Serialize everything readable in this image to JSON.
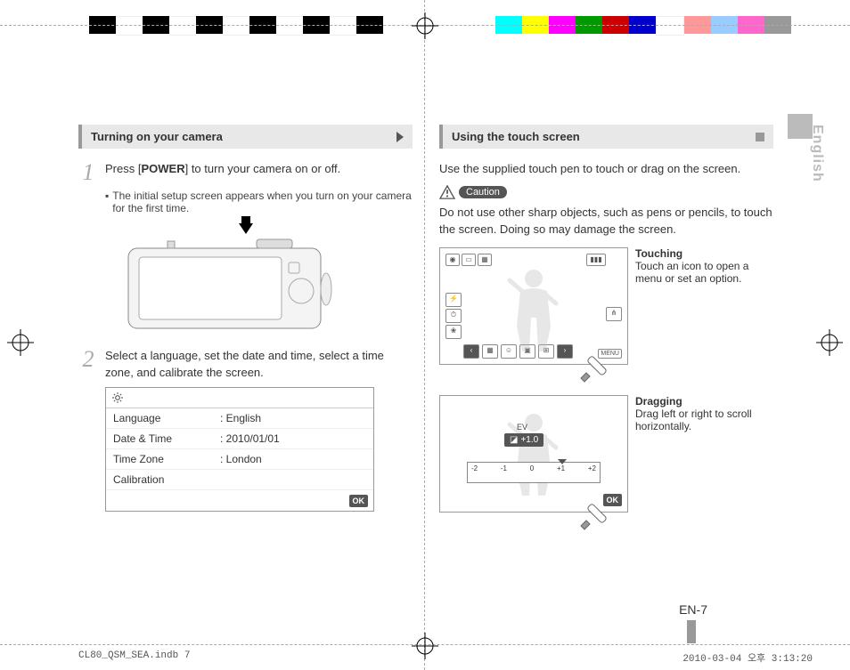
{
  "lang_tab": "English",
  "page_number": "EN-7",
  "footer": {
    "file": "CL80_QSM_SEA.indb   7",
    "timestamp": "2010-03-04   오후 3:13:20"
  },
  "left": {
    "header": "Turning on your camera",
    "step1_pre": "Press [",
    "step1_bold": "POWER",
    "step1_post": "] to turn your camera on or off.",
    "bullet1": "The initial setup screen appears when you turn on your camera for the first time.",
    "step2": "Select a language, set the date and time, select a time zone, and calibrate the screen.",
    "settings": {
      "rows": [
        {
          "label": "Language",
          "value": ": English"
        },
        {
          "label": "Date & Time",
          "value": ": 2010/01/01"
        },
        {
          "label": "Time Zone",
          "value": ": London"
        },
        {
          "label": "Calibration",
          "value": ""
        }
      ],
      "ok": "OK"
    }
  },
  "right": {
    "header": "Using the touch screen",
    "intro": "Use the supplied touch pen to touch or drag on the screen.",
    "caution_label": "Caution",
    "caution_text": "Do not use other sharp objects, such as pens or pencils, to touch the screen. Doing so may damage the screen.",
    "touching": {
      "title": "Touching",
      "body": "Touch an icon to open a menu or set an option."
    },
    "dragging": {
      "title": "Dragging",
      "body": "Drag left or right to scroll horizontally.",
      "ev_label": "EV",
      "ev_value": "+1.0",
      "scale": [
        "-2",
        "-1",
        "0",
        "+1",
        "+2"
      ],
      "ok": "OK"
    },
    "menu_label": "MENU"
  }
}
